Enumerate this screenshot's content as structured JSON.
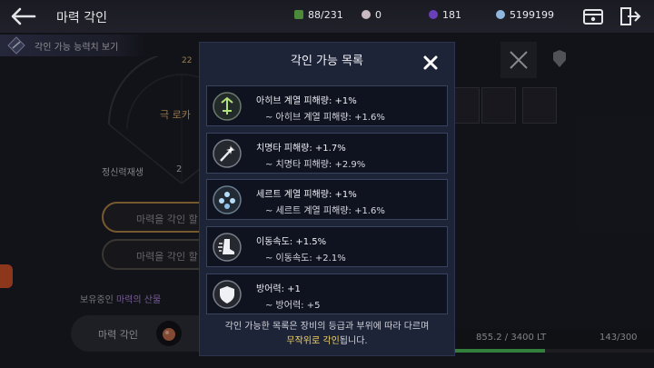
{
  "header": {
    "title": "마력 각인",
    "stats": [
      {
        "icon": "green-gem-icon",
        "value": "88/231",
        "color": "#4c8a3a"
      },
      {
        "icon": "pearl-icon",
        "value": "0",
        "color": "#c9b9c2"
      },
      {
        "icon": "purple-orb-icon",
        "value": "181",
        "color": "#6a3fb8"
      },
      {
        "icon": "crystal-icon",
        "value": "5199199",
        "color": "#8fb7de"
      }
    ]
  },
  "subbar": {
    "label": "각인 가능 능력치 보기"
  },
  "left_panel": {
    "level_badge": "22",
    "gold_text": "극 로카",
    "recover_label": "정신력재생",
    "recover_value": "2",
    "pill1_label": "마력을 각인 할",
    "pill2_label": "마력을 각인 할",
    "held_prefix": "보유중인 ",
    "held_highlight": "마력의 산물",
    "bottom_label": "마력 각인"
  },
  "right_panel": {
    "bottom_value": "855.2 / 3400 LT",
    "bottom_count": "143/300",
    "bottom_fill_fraction": 0.477
  },
  "modal": {
    "title": "각인 가능 목록",
    "items": [
      {
        "icon": "archive-rune-icon",
        "line1": "아히브 계열 피해량: +1%",
        "line2": "~ 아히브 계열 피해량: +1.6%"
      },
      {
        "icon": "critical-sword-icon",
        "line1": "치명타 피해량: +1.7%",
        "line2": "~ 치명타 피해량: +2.9%"
      },
      {
        "icon": "sert-rune-icon",
        "line1": "세르트 계열 피해량: +1%",
        "line2": "~ 세르트 계열 피해량: +1.6%"
      },
      {
        "icon": "boot-speed-icon",
        "line1": "이동속도: +1.5%",
        "line2": "~ 이동속도: +2.1%"
      },
      {
        "icon": "shield-icon",
        "line1": "방어력: +1",
        "line2": "~ 방어력: +5"
      }
    ],
    "foot_line1": "각인 가능한 목록은 장비의 등급과 부위에 따라 다르며",
    "foot_hl": "무작위로 각인",
    "foot_rest": "됩니다."
  }
}
